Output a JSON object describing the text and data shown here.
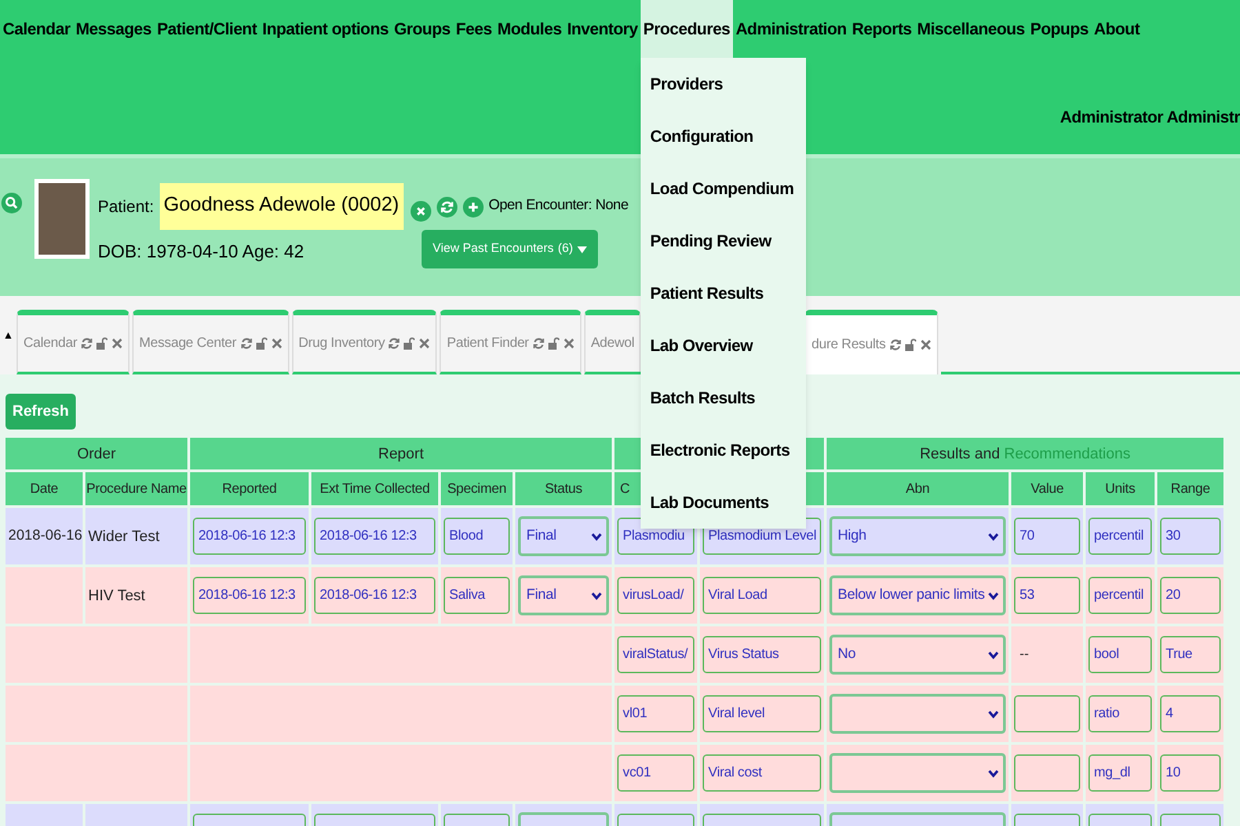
{
  "menu": {
    "items": [
      {
        "label": "Calendar",
        "selected": false
      },
      {
        "label": "Messages",
        "selected": false
      },
      {
        "label": "Patient/Client",
        "selected": false
      },
      {
        "label": "Inpatient options",
        "selected": false
      },
      {
        "label": "Groups",
        "selected": false
      },
      {
        "label": "Fees",
        "selected": false
      },
      {
        "label": "Modules",
        "selected": false
      },
      {
        "label": "Inventory",
        "selected": false
      },
      {
        "label": "Procedures",
        "selected": true
      },
      {
        "label": "Administration",
        "selected": false
      },
      {
        "label": "Reports",
        "selected": false
      },
      {
        "label": "Miscellaneous",
        "selected": false
      },
      {
        "label": "Popups",
        "selected": false
      },
      {
        "label": "About",
        "selected": false
      }
    ],
    "dropdown": [
      "Providers",
      "Configuration",
      "Load Compendium",
      "Pending Review",
      "Patient Results",
      "Lab Overview",
      "Batch Results",
      "Electronic Reports",
      "Lab Documents"
    ]
  },
  "user": "Administrator Administr",
  "patient": {
    "label": "Patient:",
    "name": "Goodness Adewole (0002)",
    "dob_line": "DOB: 1978-04-10 Age: 42",
    "encounter": "Open Encounter: None",
    "past_button": "View Past Encounters",
    "past_count": "(6)"
  },
  "tabs": {
    "collapse": "▲",
    "items": [
      {
        "label": "Calendar",
        "selected": false,
        "controls": true
      },
      {
        "label": "Message Center",
        "selected": false,
        "controls": true
      },
      {
        "label": "Drug Inventory",
        "selected": false,
        "controls": true
      },
      {
        "label": "Patient Finder",
        "selected": false,
        "controls": true
      },
      {
        "label": "Adewol",
        "selected": false,
        "controls": false
      },
      {
        "label": "dure Results",
        "selected": true,
        "controls": true
      }
    ]
  },
  "refresh_button": "Refresh",
  "table": {
    "groups": [
      {
        "label": "Order",
        "columns": [
          {
            "label": "Date"
          },
          {
            "label": "Procedure Name"
          }
        ]
      },
      {
        "label": "Report",
        "columns": [
          {
            "label": "Reported"
          },
          {
            "label": "Ext Time Collected"
          },
          {
            "label": "Specimen"
          },
          {
            "label": "Status"
          }
        ]
      },
      {
        "columns": [
          {
            "label": "C"
          },
          {}
        ]
      },
      {
        "label": "Results and",
        "accent": "Recommendations",
        "columns": [
          {
            "label": "Abn"
          },
          {
            "label": "Value"
          },
          {
            "label": "Units"
          },
          {
            "label": "Range"
          }
        ]
      }
    ],
    "rows": [
      {
        "kind": "order",
        "color": "#dcdcfc",
        "date": "2018-06-16",
        "procedure": "Wider Test",
        "reported": "2018-06-16 12:3",
        "collected": "2018-06-16 12:3",
        "specimen": "Blood",
        "status": "Final",
        "code": "Plasmodiu",
        "name": "Plasmodium Level",
        "abn": "High",
        "value": "70",
        "value_editable": true,
        "units": "percentil",
        "range": "30"
      },
      {
        "kind": "order",
        "color": "#ffdcdc",
        "procedure": "HIV Test",
        "reported": "2018-06-16 12:3",
        "collected": "2018-06-16 12:3",
        "specimen": "Saliva",
        "status": "Final",
        "code": "virusLoad/",
        "name": "Viral Load",
        "abn": "Below lower panic limits",
        "value": "53",
        "value_editable": true,
        "units": "percentil",
        "range": "20"
      },
      {
        "kind": "result",
        "color": "#ffdcdc",
        "code": "viralStatus/",
        "name": "Virus Status",
        "abn": "No",
        "value": "--",
        "value_editable": false,
        "units": "bool",
        "range": "True"
      },
      {
        "kind": "result",
        "color": "#ffdcdc",
        "code": "vl01",
        "name": "Viral level",
        "value_editable": true,
        "units": "ratio",
        "range": "4"
      },
      {
        "kind": "result",
        "color": "#ffdcdc",
        "code": "vc01",
        "name": "Viral cost",
        "value_editable": true,
        "units": "mg_dl",
        "range": "10"
      },
      {
        "kind": "order",
        "color": "#dcdcfc",
        "value_editable": true
      }
    ]
  }
}
